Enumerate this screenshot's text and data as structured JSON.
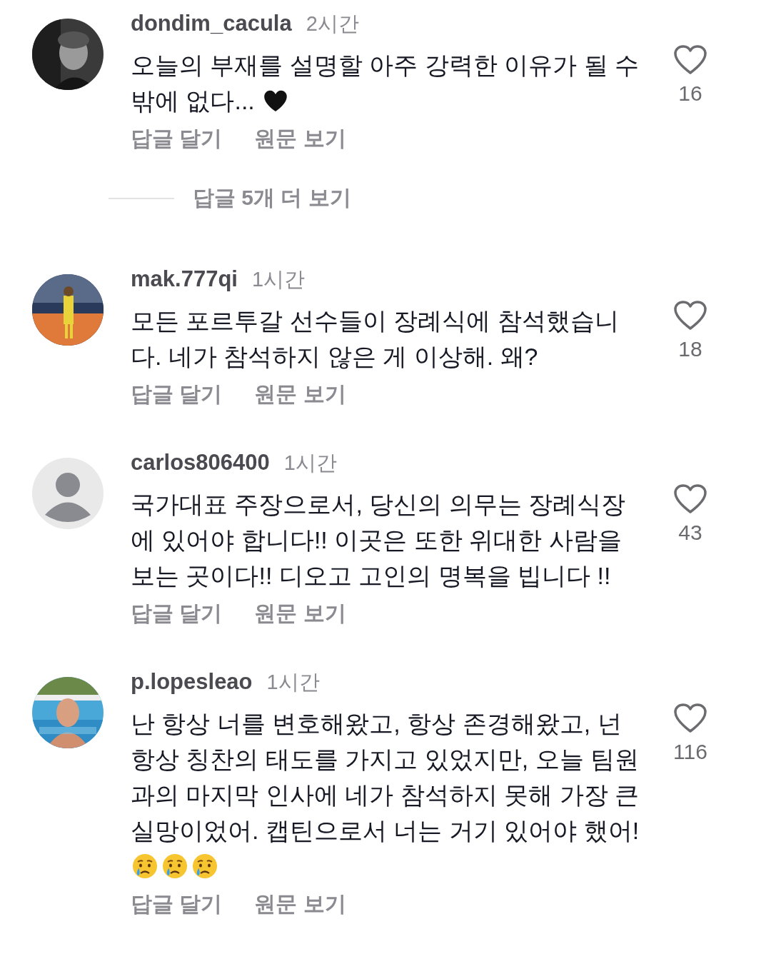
{
  "comments": [
    {
      "avatar": {
        "kind": "picture"
      },
      "username": "dondim_cacula",
      "time": "2시간",
      "text": "오늘의 부재를 설명할 아주 강력한 이유가 될 수 밖에 없다...",
      "emojis": [
        {
          "kind": "heart"
        }
      ],
      "likes": "16",
      "actions": [
        "답글 달기",
        "원문 보기"
      ],
      "more_replies": "답글 5개 더 보기"
    },
    {
      "avatar": {
        "kind": "picture"
      },
      "username": "mak.777qi",
      "time": "1시간",
      "text": "모든 포르투갈 선수들이 장례식에 참석했습니다. 네가 참석하지 않은 게 이상해. 왜?",
      "likes": "18",
      "actions": [
        "답글 달기",
        "원문 보기"
      ]
    },
    {
      "avatar": {
        "kind": "silhouette"
      },
      "username": "carlos806400",
      "time": "1시간",
      "text": "국가대표 주장으로서, 당신의 의무는 장례식장에 있어야 합니다!! 이곳은 또한 위대한 사람을 보는 곳이다!! 디오고 고인의 명복을 빕니다 !!",
      "likes": "43",
      "actions": [
        "답글 달기",
        "원문 보기"
      ]
    },
    {
      "avatar": {
        "kind": "picture"
      },
      "username": "p.lopesleao",
      "time": "1시간",
      "text": "난 항상 너를 변호해왔고, 항상 존경해왔고, 넌 항상 칭찬의 태도를 가지고 있었지만, 오늘 팀원과의 마지막 인사에 네가 참석하지 못해 가장 큰 실망이었어. 캡틴으로서 너는 거기 있어야 했어!",
      "emojis": [
        {
          "kind": "crying-face"
        },
        {
          "kind": "crying-face"
        },
        {
          "kind": "crying-face"
        }
      ],
      "likes": "116",
      "actions": [
        "답글 달기",
        "원문 보기"
      ]
    }
  ]
}
